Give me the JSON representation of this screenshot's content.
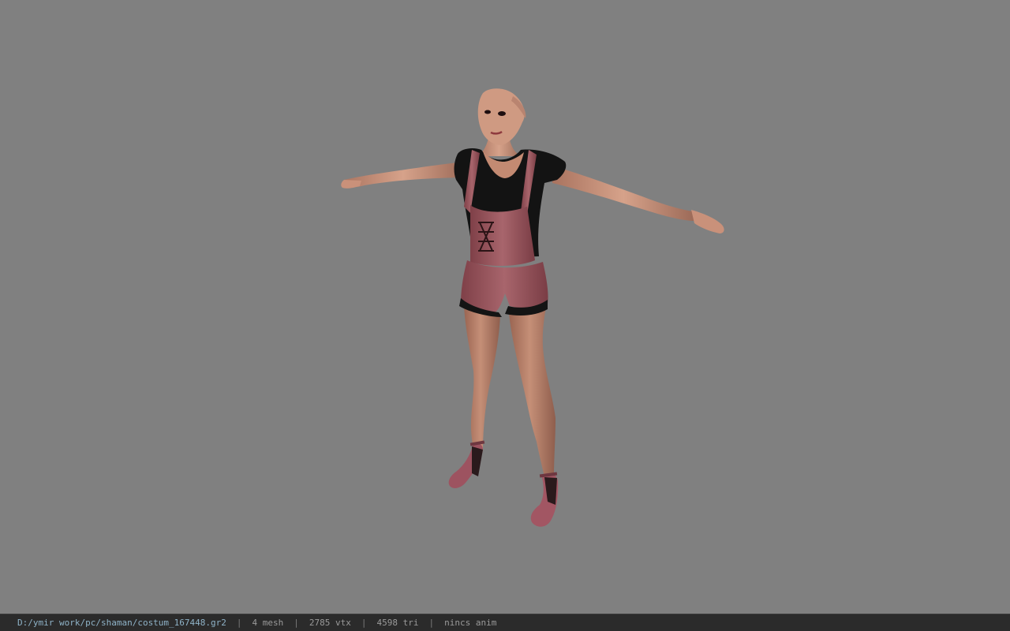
{
  "viewport": {
    "background_color": "#808080"
  },
  "model": {
    "skin_color": "#c99680",
    "top_color": "#111111",
    "overall_color": "#9e5c63",
    "shoe_color": "#a65864"
  },
  "status_bar": {
    "file_path": "D:/ymir work/pc/shaman/costum_167448.gr2",
    "separator": "|",
    "mesh_count": "4 mesh",
    "vertex_count": "2785 vtx",
    "triangle_count": "4598 tri",
    "animation": "nincs anim"
  }
}
